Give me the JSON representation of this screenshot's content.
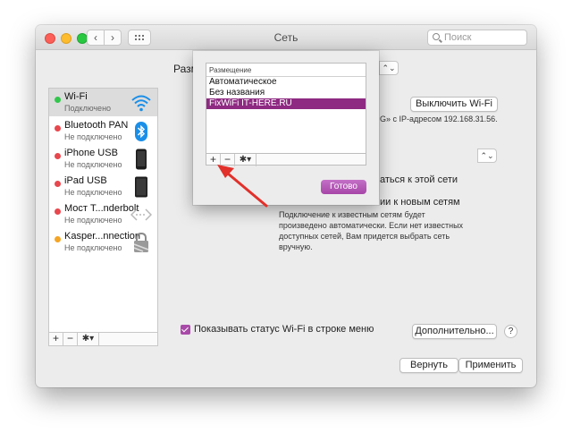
{
  "window": {
    "title": "Сеть",
    "search_placeholder": "Поиск",
    "back_glyph": "‹",
    "forward_glyph": "›"
  },
  "location": {
    "label_fragment": "Разм",
    "select_arrow": "⌃⌄"
  },
  "sidebar": {
    "items": [
      {
        "name": "Wi-Fi",
        "status": "Подключено",
        "dot": "#31c74c",
        "icon": "wifi-icon",
        "selected": true
      },
      {
        "name": "Bluetooth PAN",
        "status": "Не подключено",
        "dot": "#e8474d",
        "icon": "bluetooth-icon"
      },
      {
        "name": "iPhone USB",
        "status": "Не подключено",
        "dot": "#e8474d",
        "icon": "iphone-icon"
      },
      {
        "name": "iPad USB",
        "status": "Не подключено",
        "dot": "#e8474d",
        "icon": "ipad-icon"
      },
      {
        "name": "Мост T...nderbolt",
        "status": "Не подключено",
        "dot": "#e8474d",
        "icon": "thunderbolt-bridge-icon"
      },
      {
        "name": "Kasper...nnection",
        "status": "Не подключено",
        "dot": "#f5a524",
        "icon": "vpn-lock-icon"
      }
    ],
    "toolbar": {
      "add": "+",
      "remove": "−",
      "gear": "✱▾"
    }
  },
  "panel": {
    "turn_off_wifi": "Выключить Wi-Fi",
    "status_fragment": "G» с IP-адресом 192.168.31.56.",
    "ask_fragment_1": "аться к этой сети",
    "ask_fragment_2": "ии к новым сетям",
    "note": "Подключение к известным сетям будет произведено автоматически. Если нет известных доступных сетей, Вам придется выбрать сеть вручную.",
    "show_status_label": "Показывать статус Wi-Fi в строке меню",
    "advanced_button": "Дополнительно...",
    "help": "?"
  },
  "footer": {
    "revert": "Вернуть",
    "apply": "Применить"
  },
  "sheet": {
    "header": "Размещение",
    "locations": [
      {
        "name": "Автоматическое"
      },
      {
        "name": "Без названия"
      },
      {
        "name": "FixWiFi IT-HERE.RU",
        "selected": true
      }
    ],
    "toolbar": {
      "add": "+",
      "remove": "−",
      "gear": "✱▾"
    },
    "done": "Готово"
  },
  "colors": {
    "accent": "#a84aa8",
    "selection": "#8e2a82",
    "arrow": "#e2302a"
  }
}
